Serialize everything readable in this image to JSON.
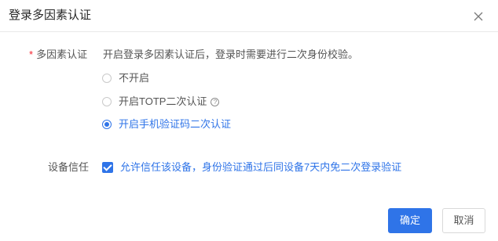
{
  "dialog": {
    "title": "登录多因素认证",
    "close_icon": "close-icon"
  },
  "mfa": {
    "required_mark": "*",
    "label": "多因素认证",
    "description": "开启登录多因素认证后，登录时需要进行二次身份校验。",
    "options": [
      {
        "label": "不开启",
        "checked": false
      },
      {
        "label": "开启TOTP二次认证",
        "checked": false,
        "help_icon": "question-circle-icon",
        "help_glyph": "?"
      },
      {
        "label": "开启手机验证码二次认证",
        "checked": true
      }
    ]
  },
  "trust": {
    "label": "设备信任",
    "checkbox_label": "允许信任该设备，身份验证通过后同设备7天内免二次登录验证",
    "checked": true
  },
  "footer": {
    "ok_label": "确定",
    "cancel_label": "取消"
  },
  "colors": {
    "primary": "#2f74e8",
    "required": "#f5222d"
  }
}
